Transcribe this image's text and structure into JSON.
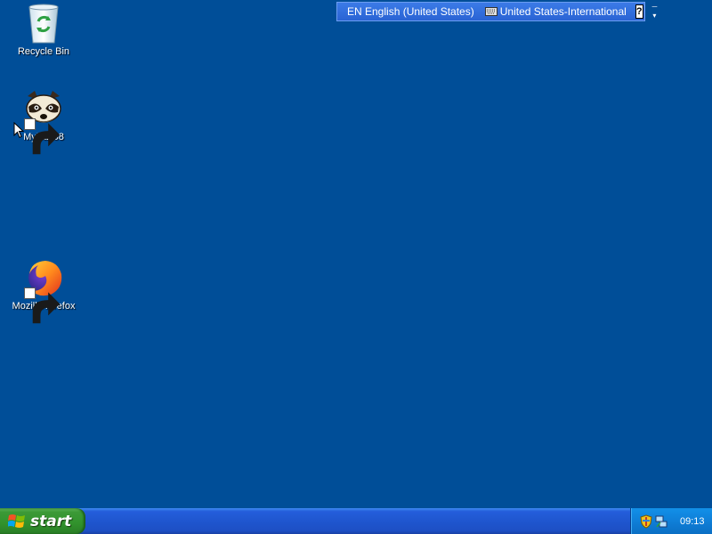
{
  "desktop": {
    "background_color": "#004e98",
    "icons": [
      {
        "label": "Recycle Bin",
        "icon": "recycle-bin-icon",
        "shortcut": false
      },
      {
        "label": "MyPal 68",
        "icon": "mypal-raccoon-icon",
        "shortcut": true
      },
      {
        "label": "Mozilla Firefox",
        "icon": "firefox-icon",
        "shortcut": true
      }
    ]
  },
  "language_bar": {
    "language": "EN English (United States)",
    "keyboard_layout": "United States-International",
    "help_label": "?"
  },
  "taskbar": {
    "start_label": "start",
    "clock": "09:13",
    "tray_icons": [
      "security-shield-icon",
      "network-connection-icon"
    ]
  },
  "colors": {
    "taskbar_blue": "#245edb",
    "start_green": "#3c9a37",
    "tray_blue": "#0f7fd8"
  }
}
